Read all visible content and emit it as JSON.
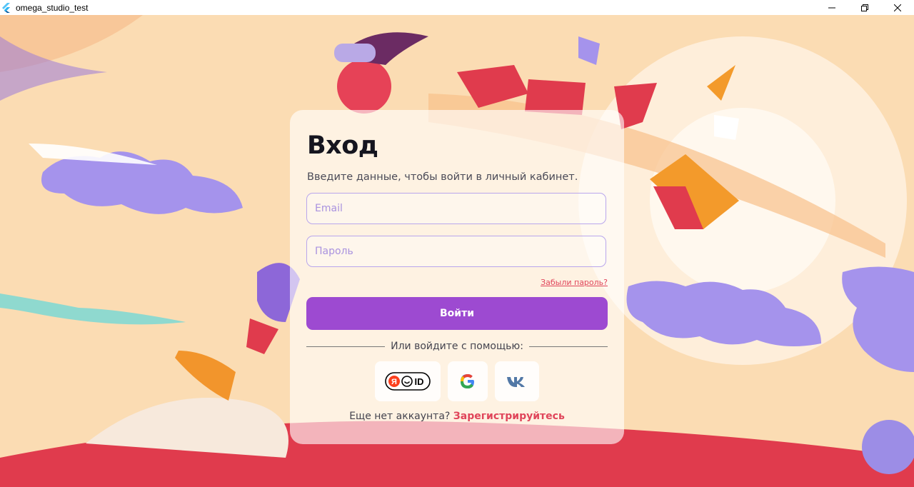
{
  "window": {
    "title": "omega_studio_test",
    "controls": [
      "minimize",
      "restore",
      "close"
    ]
  },
  "login": {
    "title": "Вход",
    "subtitle": "Введите данные, чтобы войти в личный кабинет.",
    "email_placeholder": "Email",
    "email_value": "",
    "password_placeholder": "Пароль",
    "password_value": "",
    "forgot_label": "Забыли пароль?",
    "submit_label": "Войти",
    "divider_label": "Или войдите с помощью:",
    "social": [
      {
        "name": "yandex-id",
        "label_ya": "Я",
        "label_id": "ID"
      },
      {
        "name": "google",
        "label": "G"
      },
      {
        "name": "vk",
        "label": "vk"
      }
    ],
    "register_prompt": "Еще нет аккаунта?",
    "register_link": "Зарегистрируйтесь"
  },
  "colors": {
    "accent": "#9d4ad1",
    "link": "#e0455a",
    "field_border": "#b9a6ec",
    "background_peach": "#fbe3c2"
  }
}
